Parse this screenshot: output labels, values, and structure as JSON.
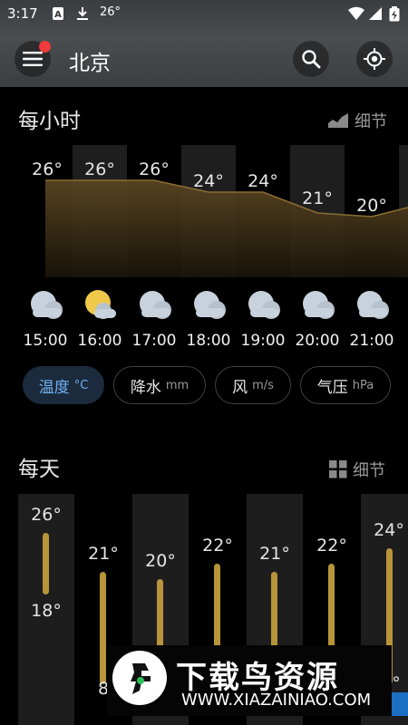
{
  "status_bar": {
    "time": "3:17",
    "temperature": "26°"
  },
  "header": {
    "city": "北京"
  },
  "hourly": {
    "title": "每小时",
    "detail_label": "细节",
    "temps": [
      "26°",
      "26°",
      "26°",
      "24°",
      "24°",
      "21°",
      "20°"
    ],
    "times": [
      "15:00",
      "16:00",
      "17:00",
      "18:00",
      "19:00",
      "20:00",
      "21:00"
    ],
    "icons": [
      "cloud-icon",
      "partly-sunny-icon",
      "cloud-icon",
      "cloud-icon",
      "cloud-icon",
      "cloud-icon",
      "cloud-icon"
    ],
    "chips": [
      {
        "label": "温度",
        "unit": "°C",
        "active": true
      },
      {
        "label": "降水",
        "unit": "mm",
        "active": false
      },
      {
        "label": "风",
        "unit": "m/s",
        "active": false
      },
      {
        "label": "气压",
        "unit": "hPa",
        "active": false
      }
    ]
  },
  "daily": {
    "title": "每天",
    "detail_label": "细节",
    "highs": [
      "26°",
      "21°",
      "20°",
      "22°",
      "21°",
      "22°",
      "24°"
    ],
    "lows": [
      "18°",
      "8",
      "",
      "",
      "",
      "",
      "°"
    ]
  },
  "watermark": {
    "title": "下载鸟资源",
    "url": "WWW.XIAZAINIAO.COM"
  },
  "colors": {
    "accent_blue": "#6fb0ef",
    "bar_gold": "#b8943a",
    "red_badge": "#f23a3a"
  }
}
